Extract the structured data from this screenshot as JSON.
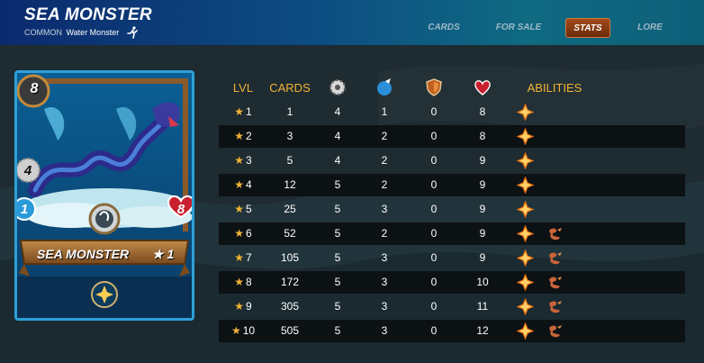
{
  "header": {
    "title": "SEA MONSTER",
    "rarity": "COMMON",
    "element_type": "Water Monster",
    "run_icon": "running-figure-icon"
  },
  "tabs": [
    {
      "label": "CARDS",
      "active": false
    },
    {
      "label": "FOR SALE",
      "active": false
    },
    {
      "label": "STATS",
      "active": true
    },
    {
      "label": "LORE",
      "active": false
    }
  ],
  "card": {
    "name": "SEA MONSTER",
    "level": "★ 1",
    "mana": "8",
    "attack": "4",
    "speed": "1",
    "health": "8",
    "ability_icon": "sparkle-icon"
  },
  "table": {
    "headers": {
      "lvl": "LVL",
      "cards": "CARDS",
      "abilities": "ABILITIES",
      "attack_icon": "melee-attack-icon",
      "speed_icon": "speed-icon",
      "armor_icon": "armor-shield-icon",
      "health_icon": "heart-icon"
    },
    "rows": [
      {
        "lvl": "1",
        "cards": "1",
        "atk": "4",
        "spd": "1",
        "arm": "0",
        "hp": "8",
        "abilities": 1
      },
      {
        "lvl": "2",
        "cards": "3",
        "atk": "4",
        "spd": "2",
        "arm": "0",
        "hp": "8",
        "abilities": 1
      },
      {
        "lvl": "3",
        "cards": "5",
        "atk": "4",
        "spd": "2",
        "arm": "0",
        "hp": "9",
        "abilities": 1
      },
      {
        "lvl": "4",
        "cards": "12",
        "atk": "5",
        "spd": "2",
        "arm": "0",
        "hp": "9",
        "abilities": 1
      },
      {
        "lvl": "5",
        "cards": "25",
        "atk": "5",
        "spd": "3",
        "arm": "0",
        "hp": "9",
        "abilities": 1
      },
      {
        "lvl": "6",
        "cards": "52",
        "atk": "5",
        "spd": "2",
        "arm": "0",
        "hp": "9",
        "abilities": 2
      },
      {
        "lvl": "7",
        "cards": "105",
        "atk": "5",
        "spd": "3",
        "arm": "0",
        "hp": "9",
        "abilities": 2
      },
      {
        "lvl": "8",
        "cards": "172",
        "atk": "5",
        "spd": "3",
        "arm": "0",
        "hp": "10",
        "abilities": 2
      },
      {
        "lvl": "9",
        "cards": "305",
        "atk": "5",
        "spd": "3",
        "arm": "0",
        "hp": "11",
        "abilities": 2
      },
      {
        "lvl": "10",
        "cards": "505",
        "atk": "5",
        "spd": "3",
        "arm": "0",
        "hp": "12",
        "abilities": 2
      }
    ],
    "ability_icons": [
      "sparkle-icon",
      "fire-dragon-icon"
    ]
  },
  "colors": {
    "header_accent": "#f2b335",
    "active_tab": "#a44a1a",
    "card_border": "#2ea0d8"
  }
}
